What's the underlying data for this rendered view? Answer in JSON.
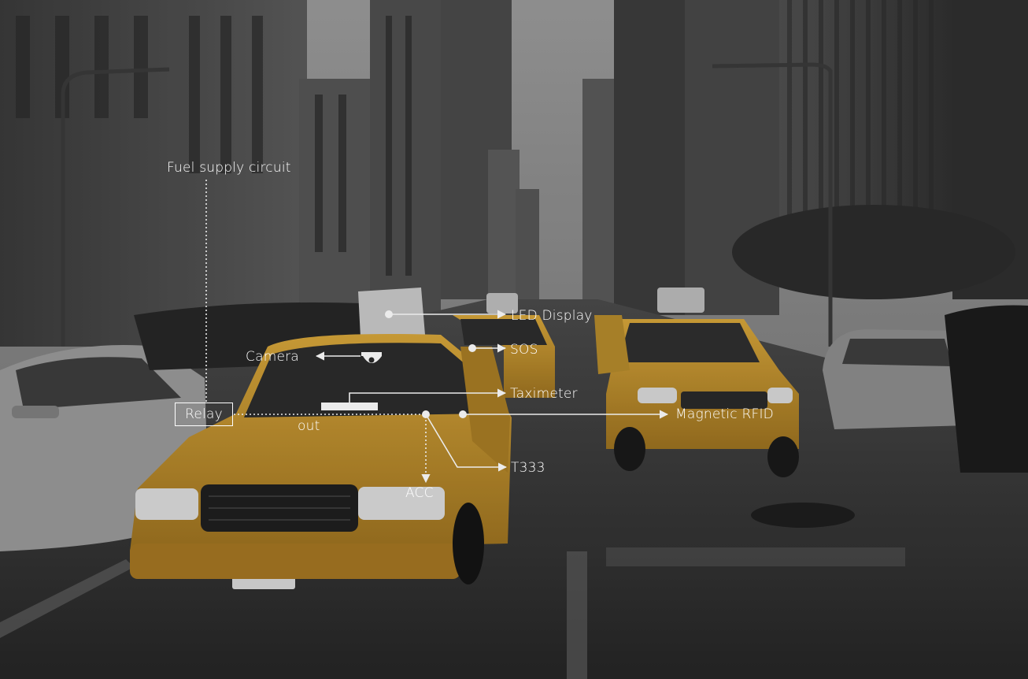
{
  "labels": {
    "fuel_supply_circuit": "Fuel supply circuit",
    "led_display": "LED Display",
    "sos": "SOS",
    "camera": "Camera",
    "taximeter": "Taximeter",
    "relay": "Relay",
    "out": "out",
    "magnetic_rfid": "Magnetic RFID",
    "t333": "T333",
    "acc": "ACC"
  },
  "colors": {
    "sky": "#8d8d8d",
    "ground": "#2e2e2e",
    "taxi_yellow": "#c9962a",
    "annotation": "#ffffff"
  },
  "icons": {
    "camera": "dome-camera-icon"
  }
}
